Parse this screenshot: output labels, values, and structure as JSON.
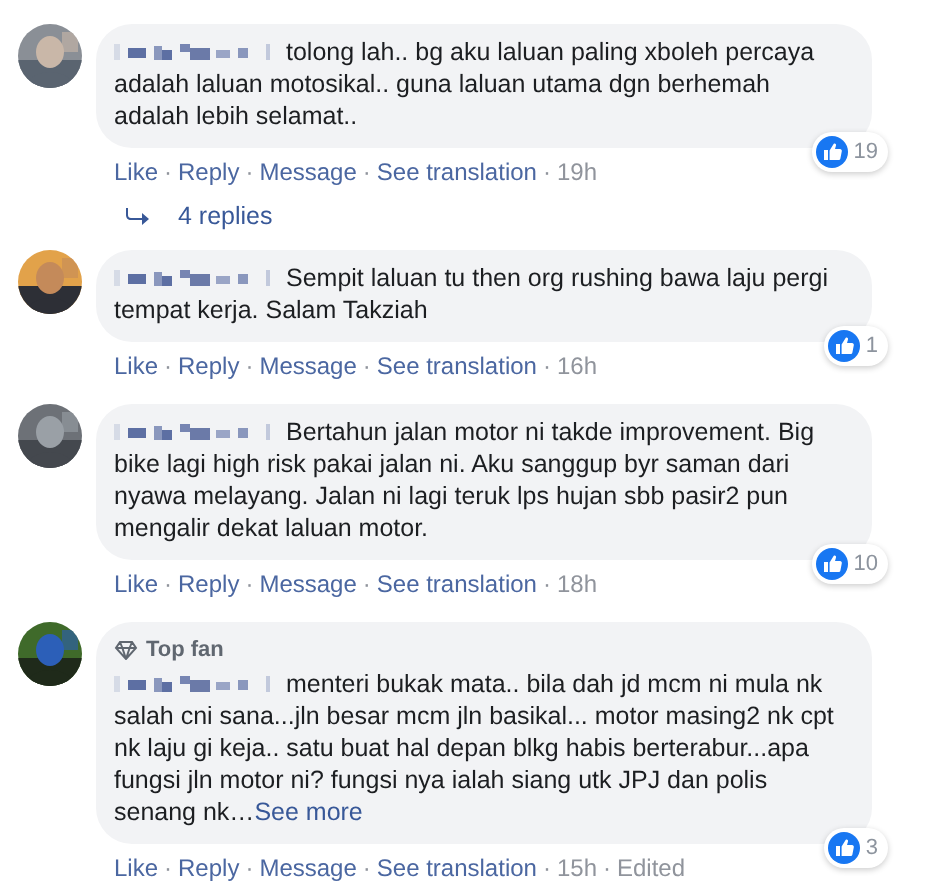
{
  "separator": "·",
  "comments": [
    {
      "text": "tolong lah.. bg aku laluan paling xboleh percaya adalah laluan motosikal.. guna laluan utama dgn berhemah adalah lebih selamat..",
      "actions": [
        "Like",
        "Reply",
        "Message",
        "See translation"
      ],
      "time": "19h",
      "reactions": "19",
      "replies": "4 replies"
    },
    {
      "text": "Sempit laluan tu then org rushing bawa laju pergi tempat kerja. Salam Takziah",
      "actions": [
        "Like",
        "Reply",
        "Message",
        "See translation"
      ],
      "time": "16h",
      "reactions": "1"
    },
    {
      "text": "Bertahun jalan motor ni takde improvement. Big bike lagi high risk pakai jalan ni. Aku sanggup byr saman dari nyawa melayang. Jalan ni lagi teruk lps hujan sbb pasir2 pun mengalir dekat laluan motor.",
      "actions": [
        "Like",
        "Reply",
        "Message",
        "See translation"
      ],
      "time": "18h",
      "reactions": "10"
    },
    {
      "top_fan": "Top fan",
      "text": "menteri bukak mata.. bila dah jd mcm ni mula nk salah cni sana...jln besar mcm jln basikal... motor masing2 nk cpt nk laju gi keja.. satu buat hal depan blkg habis berterabur...apa fungsi jln motor ni? fungsi nya ialah siang utk JPJ dan polis senang nk…",
      "see_more": "See more",
      "actions": [
        "Like",
        "Reply",
        "Message",
        "See translation"
      ],
      "time": "15h",
      "edited": "Edited",
      "reactions": "3"
    }
  ]
}
